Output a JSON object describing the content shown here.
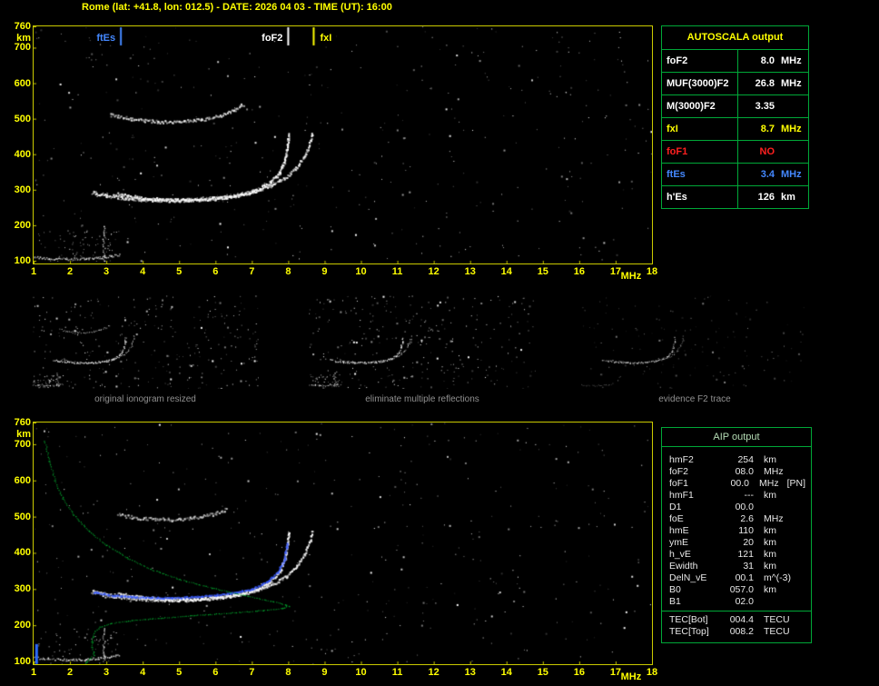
{
  "title": "Rome (lat: +41.8, lon: 012.5) - DATE: 2026 04 03 - TIME (UT): 16:00",
  "colors": {
    "accent_yellow": "#ffff00",
    "axis_border_yellow": "#caca00",
    "table_green": "#00a838",
    "trace_white": "#ffffff",
    "profile_green": "#00bb33",
    "fitted_blue": "#3a5cff",
    "ftes_blue": "#4488ff",
    "warning_red": "#ff2020",
    "caption_gray": "#909090"
  },
  "autoscala_table": {
    "title": "AUTOSCALA output",
    "rows": [
      {
        "param": "foF2",
        "value": "8.0",
        "unit": "MHz",
        "color": "#ffffff"
      },
      {
        "param": "MUF(3000)F2",
        "value": "26.8",
        "unit": "MHz",
        "color": "#ffffff"
      },
      {
        "param": "M(3000)F2",
        "value": "3.35",
        "unit": "",
        "color": "#ffffff"
      },
      {
        "param": "fxI",
        "value": "8.7",
        "unit": "MHz",
        "color": "#ffff00"
      },
      {
        "param": "foF1",
        "value": "NO",
        "unit": "",
        "color": "#ff2020"
      },
      {
        "param": "ftEs",
        "value": "3.4",
        "unit": "MHz",
        "color": "#4488ff"
      },
      {
        "param": "h'Es",
        "value": "126",
        "unit": "km",
        "color": "#ffffff"
      }
    ]
  },
  "thumbnails": [
    {
      "caption": "original ionogram resized"
    },
    {
      "caption": "eliminate multiple reflections"
    },
    {
      "caption": "evidence F2 trace"
    }
  ],
  "aip_table": {
    "title": "AIP output",
    "rows": [
      {
        "name": "hmF2",
        "value": "254",
        "unit": "km"
      },
      {
        "name": "foF2",
        "value": "08.0",
        "unit": "MHz"
      },
      {
        "name": "foF1",
        "value": "00.0",
        "unit": "MHz",
        "extra": "[PN]"
      },
      {
        "name": "hmF1",
        "value": "---",
        "unit": "km"
      },
      {
        "name": "D1",
        "value": "00.0",
        "unit": ""
      },
      {
        "name": "foE",
        "value": "2.6",
        "unit": "MHz"
      },
      {
        "name": "hmE",
        "value": "110",
        "unit": "km"
      },
      {
        "name": "ymE",
        "value": "20",
        "unit": "km"
      },
      {
        "name": "h_vE",
        "value": "121",
        "unit": "km"
      },
      {
        "name": "Ewidth",
        "value": "31",
        "unit": "km"
      },
      {
        "name": "DelN_vE",
        "value": "00.1",
        "unit": "m^(-3)"
      },
      {
        "name": "B0",
        "value": "057.0",
        "unit": "km"
      },
      {
        "name": "B1",
        "value": "02.0",
        "unit": ""
      },
      {
        "name": "TEC[Bot]",
        "value": "004.4",
        "unit": "TECU",
        "sep_above": true
      },
      {
        "name": "TEC[Top]",
        "value": "008.2",
        "unit": "TECU"
      }
    ]
  },
  "chart_data": [
    {
      "type": "scatter",
      "name": "ionogram-autoscaled",
      "title": "",
      "xlabel": "MHz",
      "ylabel": "km",
      "xlim": [
        1,
        18
      ],
      "ylim": [
        100,
        760
      ],
      "grid": false,
      "x_ticks": [
        1,
        2,
        3,
        4,
        5,
        6,
        7,
        8,
        9,
        10,
        11,
        12,
        13,
        14,
        15,
        16,
        17,
        18
      ],
      "y_ticks": [
        760,
        700,
        600,
        500,
        400,
        300,
        200,
        100
      ],
      "markers": [
        {
          "label": "ftEs",
          "freq": 3.4,
          "color": "#4488ff",
          "label_side": "left"
        },
        {
          "label": "foF2",
          "freq": 8.0,
          "color": "#ffffff",
          "label_side": "left"
        },
        {
          "label": "fxI",
          "freq": 8.7,
          "color": "#ffff00",
          "label_side": "right"
        }
      ],
      "traces": {
        "f2_ordinary": [
          [
            2.6,
            295
          ],
          [
            3.0,
            285
          ],
          [
            3.6,
            277
          ],
          [
            4.4,
            272
          ],
          [
            5.2,
            272
          ],
          [
            6.0,
            277
          ],
          [
            6.6,
            286
          ],
          [
            7.1,
            300
          ],
          [
            7.5,
            322
          ],
          [
            7.75,
            348
          ],
          [
            7.9,
            385
          ],
          [
            7.97,
            425
          ],
          [
            8.0,
            458
          ]
        ],
        "f2_extraordinary": [
          [
            3.3,
            290
          ],
          [
            4.0,
            278
          ],
          [
            4.8,
            272
          ],
          [
            5.6,
            274
          ],
          [
            6.4,
            282
          ],
          [
            7.0,
            294
          ],
          [
            7.5,
            312
          ],
          [
            7.9,
            334
          ],
          [
            8.2,
            362
          ],
          [
            8.45,
            398
          ],
          [
            8.6,
            438
          ],
          [
            8.65,
            462
          ]
        ],
        "f2_multiple": [
          [
            3.1,
            512
          ],
          [
            3.7,
            500
          ],
          [
            4.4,
            493
          ],
          [
            5.0,
            493
          ],
          [
            5.6,
            499
          ],
          [
            6.1,
            509
          ],
          [
            6.5,
            524
          ],
          [
            6.75,
            542
          ]
        ],
        "es_layer": [
          [
            1.0,
            112
          ],
          [
            1.4,
            108
          ],
          [
            1.9,
            106
          ],
          [
            2.4,
            107
          ],
          [
            2.8,
            110
          ],
          [
            3.1,
            114
          ],
          [
            3.35,
            118
          ]
        ],
        "es_spike": {
          "freq": 2.92,
          "h0": 100,
          "h1": 198
        }
      }
    },
    {
      "type": "scatter",
      "name": "ionogram-with-aip-profile",
      "title": "",
      "xlabel": "MHz",
      "ylabel": "km",
      "xlim": [
        1,
        18
      ],
      "ylim": [
        100,
        760
      ],
      "grid": false,
      "x_ticks": [
        1,
        2,
        3,
        4,
        5,
        6,
        7,
        8,
        9,
        10,
        11,
        12,
        13,
        14,
        15,
        16,
        17,
        18
      ],
      "y_ticks": [
        760,
        700,
        600,
        500,
        400,
        300,
        200,
        100
      ],
      "markers": [],
      "profile_peak": {
        "hmF2": 254,
        "foF2": 8.0
      },
      "traces": {
        "f2_ordinary": [
          [
            2.6,
            295
          ],
          [
            3.0,
            285
          ],
          [
            3.6,
            277
          ],
          [
            4.4,
            272
          ],
          [
            5.2,
            272
          ],
          [
            6.0,
            277
          ],
          [
            6.6,
            286
          ],
          [
            7.1,
            300
          ],
          [
            7.5,
            322
          ],
          [
            7.75,
            348
          ],
          [
            7.9,
            385
          ],
          [
            7.97,
            425
          ],
          [
            8.0,
            458
          ]
        ],
        "f2_extraordinary": [
          [
            3.3,
            290
          ],
          [
            4.0,
            278
          ],
          [
            4.8,
            272
          ],
          [
            5.6,
            274
          ],
          [
            6.4,
            282
          ],
          [
            7.0,
            294
          ],
          [
            7.5,
            312
          ],
          [
            7.9,
            334
          ],
          [
            8.2,
            362
          ],
          [
            8.45,
            398
          ],
          [
            8.6,
            438
          ],
          [
            8.65,
            462
          ]
        ],
        "f2_multiple": [
          [
            3.3,
            507
          ],
          [
            4.0,
            496
          ],
          [
            4.8,
            493
          ],
          [
            5.4,
            498
          ],
          [
            5.9,
            508
          ],
          [
            6.3,
            522
          ]
        ],
        "es_layer": [
          [
            1.0,
            112
          ],
          [
            1.4,
            108
          ],
          [
            1.9,
            106
          ],
          [
            2.4,
            107
          ],
          [
            2.8,
            110
          ],
          [
            3.1,
            114
          ],
          [
            3.35,
            118
          ]
        ],
        "es_spike": {
          "freq": 2.92,
          "h0": 100,
          "h1": 192
        },
        "fitted_trace": [
          [
            2.65,
            292
          ],
          [
            3.2,
            284
          ],
          [
            4.0,
            278
          ],
          [
            4.8,
            277
          ],
          [
            5.6,
            281
          ],
          [
            6.4,
            290
          ],
          [
            7.0,
            302
          ],
          [
            7.4,
            320
          ],
          [
            7.7,
            348
          ],
          [
            7.88,
            383
          ],
          [
            7.96,
            428
          ]
        ],
        "profile": [
          [
            1.3,
            710
          ],
          [
            1.42,
            655
          ],
          [
            1.58,
            600
          ],
          [
            1.8,
            550
          ],
          [
            2.1,
            505
          ],
          [
            2.5,
            462
          ],
          [
            3.0,
            422
          ],
          [
            3.55,
            388
          ],
          [
            4.2,
            356
          ],
          [
            5.0,
            328
          ],
          [
            5.9,
            304
          ],
          [
            6.8,
            283
          ],
          [
            7.5,
            268
          ],
          [
            7.9,
            258
          ],
          [
            8.0,
            254
          ],
          [
            7.85,
            248
          ],
          [
            7.3,
            242
          ],
          [
            6.4,
            235
          ],
          [
            5.4,
            228
          ],
          [
            4.5,
            221
          ],
          [
            3.7,
            214
          ],
          [
            3.1,
            206
          ],
          [
            2.82,
            196
          ],
          [
            2.68,
            184
          ],
          [
            2.62,
            170
          ],
          [
            2.6,
            155
          ],
          [
            2.6,
            140
          ],
          [
            2.63,
            128
          ],
          [
            2.65,
            118
          ],
          [
            2.55,
            110
          ],
          [
            2.45,
            100
          ],
          [
            2.42,
            94
          ]
        ],
        "corner_marker": {
          "freq": 1.07,
          "h0": 93,
          "h1": 148,
          "color": "#2b6bff"
        }
      }
    }
  ]
}
